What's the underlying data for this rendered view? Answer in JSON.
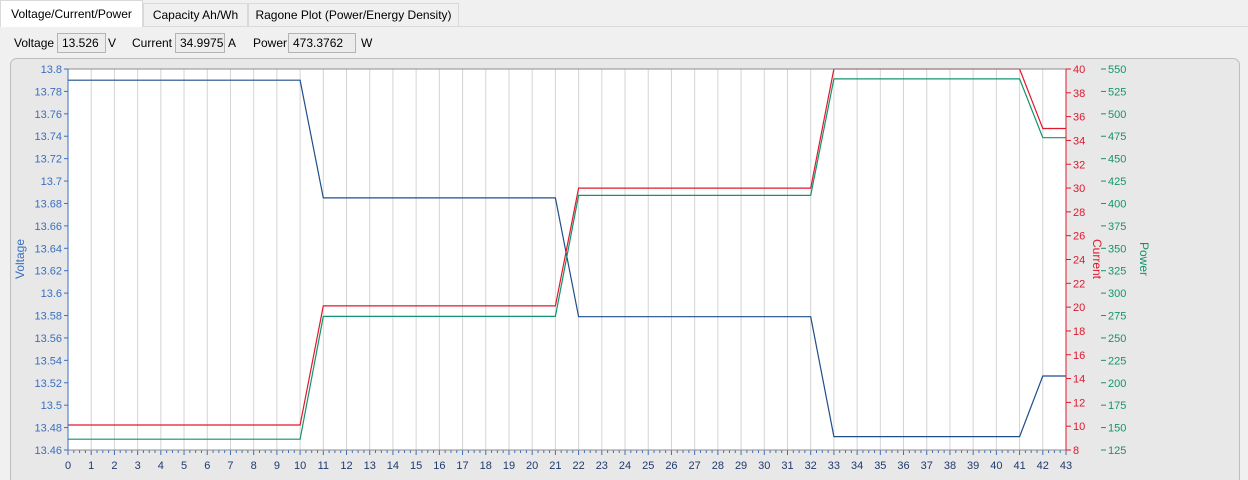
{
  "tabs": [
    {
      "label": "Voltage/Current/Power",
      "active": true
    },
    {
      "label": "Capacity Ah/Wh",
      "active": false
    },
    {
      "label": "Ragone Plot (Power/Energy Density)",
      "active": false
    }
  ],
  "readouts": {
    "voltage": {
      "label": "Voltage",
      "value": "13.526",
      "unit": "V"
    },
    "current": {
      "label": "Current",
      "value": "34.9975",
      "unit": "A"
    },
    "power": {
      "label": "Power",
      "value": "473.3762",
      "unit": "W"
    }
  },
  "colors": {
    "voltage": "#1f4e8c",
    "current": "#e0182c",
    "power": "#14946e",
    "voltage_axis": "#3a6fc0",
    "current_axis": "#e0182c",
    "power_axis": "#14946e"
  },
  "chart_data": {
    "type": "line",
    "x": [
      0,
      1,
      2,
      3,
      4,
      5,
      6,
      7,
      8,
      9,
      10,
      11,
      12,
      13,
      14,
      15,
      16,
      17,
      18,
      19,
      20,
      21,
      22,
      23,
      24,
      25,
      26,
      27,
      28,
      29,
      30,
      31,
      32,
      33,
      34,
      35,
      36,
      37,
      38,
      39,
      40,
      41,
      42,
      43
    ],
    "xlim": [
      0,
      43
    ],
    "x_ticks": [
      "0",
      "1",
      "2",
      "3",
      "4",
      "5",
      "6",
      "7",
      "8",
      "9",
      "10",
      "11",
      "12",
      "13",
      "14",
      "15",
      "16",
      "17",
      "18",
      "19",
      "20",
      "21",
      "22",
      "23",
      "24",
      "25",
      "26",
      "27",
      "28",
      "29",
      "30",
      "31",
      "32",
      "33",
      "34",
      "35",
      "36",
      "37",
      "38",
      "39",
      "40",
      "41",
      "42",
      "43"
    ],
    "y_axes": {
      "voltage": {
        "title": "Voltage",
        "ylim": [
          13.46,
          13.8
        ],
        "ticks": [
          "13.8",
          "13.78",
          "13.76",
          "13.74",
          "13.72",
          "13.7",
          "13.68",
          "13.66",
          "13.64",
          "13.62",
          "13.6",
          "13.58",
          "13.56",
          "13.54",
          "13.52",
          "13.5",
          "13.48",
          "13.46"
        ]
      },
      "current": {
        "title": "Current",
        "ylim": [
          8,
          40
        ],
        "ticks": [
          "40",
          "38",
          "36",
          "34",
          "32",
          "30",
          "28",
          "26",
          "24",
          "22",
          "20",
          "18",
          "16",
          "14",
          "12",
          "10",
          "8"
        ]
      },
      "power": {
        "title": "Power",
        "ylim": [
          125,
          550
        ],
        "ticks": [
          "550",
          "525",
          "500",
          "475",
          "450",
          "425",
          "400",
          "375",
          "350",
          "325",
          "300",
          "275",
          "250",
          "225",
          "200",
          "175",
          "150",
          "125"
        ]
      }
    },
    "series": [
      {
        "name": "Voltage",
        "axis": "voltage",
        "x": [
          0,
          10,
          11,
          21,
          22,
          32,
          33,
          41,
          42,
          43
        ],
        "y": [
          13.79,
          13.79,
          13.685,
          13.685,
          13.579,
          13.579,
          13.472,
          13.472,
          13.526,
          13.526
        ]
      },
      {
        "name": "Current",
        "axis": "current",
        "x": [
          0,
          10,
          11,
          21,
          22,
          32,
          33,
          41,
          42,
          43
        ],
        "y": [
          10.1,
          10.1,
          20.1,
          20.1,
          30.0,
          30.0,
          40.0,
          40.0,
          35.0,
          35.0
        ]
      },
      {
        "name": "Power",
        "axis": "power",
        "x": [
          0,
          10,
          11,
          21,
          22,
          32,
          33,
          41,
          42,
          43
        ],
        "y": [
          137,
          137,
          274,
          274,
          409,
          409,
          539,
          539,
          473.4,
          473.4
        ]
      }
    ]
  }
}
